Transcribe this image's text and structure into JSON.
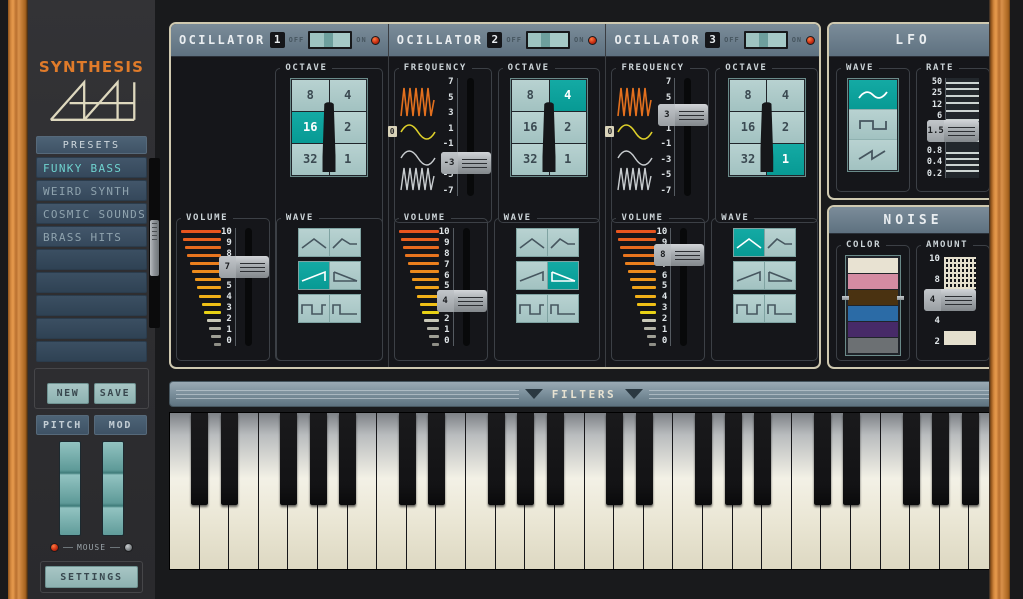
{
  "app": {
    "brand": "SYNTHESIS",
    "logo_icon": "sawtooth-logo"
  },
  "sidebar": {
    "presets_header": "PRESETS",
    "presets": [
      {
        "label": "FUNKY BASS",
        "selected": true
      },
      {
        "label": "WEIRD SYNTH",
        "selected": false
      },
      {
        "label": "COSMIC SOUNDS",
        "selected": false
      },
      {
        "label": "BRASS HITS",
        "selected": false
      },
      {
        "label": "",
        "selected": false
      },
      {
        "label": "",
        "selected": false
      },
      {
        "label": "",
        "selected": false
      },
      {
        "label": "",
        "selected": false
      },
      {
        "label": "",
        "selected": false
      }
    ],
    "new_label": "NEW",
    "save_label": "SAVE",
    "pitch_label": "PITCH",
    "mod_label": "MOD",
    "mouse_label": "MOUSE",
    "settings_label": "SETTINGS"
  },
  "oscillators": [
    {
      "title": "OCILLATOR",
      "number": "1",
      "off_label": "OFF",
      "on_label": "ON",
      "power": "mid",
      "has_frequency": false,
      "octave": {
        "label": "OCTAVE",
        "cells": [
          "8",
          "4",
          "16",
          "2",
          "32",
          "1"
        ],
        "selected": "16"
      },
      "volume": {
        "label": "VOLUME",
        "scale": [
          "10",
          "9",
          "8",
          "7",
          "6",
          "5",
          "4",
          "3",
          "2",
          "1",
          "0"
        ],
        "value": "7"
      },
      "wave": {
        "label": "WAVE",
        "icons": [
          "triangle",
          "ramp-step",
          "ramp-up",
          "ramp-down",
          "square",
          "pulse"
        ],
        "selected_index": 2
      }
    },
    {
      "title": "OCILLATOR",
      "number": "2",
      "off_label": "OFF",
      "on_label": "ON",
      "power": "mid",
      "has_frequency": true,
      "frequency": {
        "label": "FREQUENCY",
        "scale": [
          "7",
          "5",
          "3",
          "1",
          "-1",
          "-3",
          "-5",
          "-7"
        ],
        "zero_marker": "0",
        "value": "-3"
      },
      "octave": {
        "label": "OCTAVE",
        "cells": [
          "8",
          "4",
          "16",
          "2",
          "32",
          "1"
        ],
        "selected": "4"
      },
      "volume": {
        "label": "VOLUME",
        "scale": [
          "10",
          "9",
          "8",
          "7",
          "6",
          "5",
          "4",
          "3",
          "2",
          "1",
          "0"
        ],
        "value": "4"
      },
      "wave": {
        "label": "WAVE",
        "icons": [
          "triangle",
          "ramp-step",
          "ramp-up",
          "ramp-down",
          "square",
          "pulse"
        ],
        "selected_index": 3
      }
    },
    {
      "title": "OCILLATOR",
      "number": "3",
      "off_label": "OFF",
      "on_label": "ON",
      "power": "mid",
      "has_frequency": true,
      "frequency": {
        "label": "FREQUENCY",
        "scale": [
          "7",
          "5",
          "3",
          "1",
          "-1",
          "-3",
          "-5",
          "-7"
        ],
        "zero_marker": "0",
        "value": "3"
      },
      "octave": {
        "label": "OCTAVE",
        "cells": [
          "8",
          "4",
          "16",
          "2",
          "32",
          "1"
        ],
        "selected": "1"
      },
      "volume": {
        "label": "VOLUME",
        "scale": [
          "10",
          "9",
          "8",
          "7",
          "6",
          "5",
          "4",
          "3",
          "2",
          "1",
          "0"
        ],
        "value": "8"
      },
      "wave": {
        "label": "WAVE",
        "icons": [
          "triangle",
          "ramp-step",
          "ramp-up",
          "ramp-down",
          "square",
          "pulse"
        ],
        "selected_index": 0
      }
    }
  ],
  "lfo": {
    "title": "LFO",
    "wave": {
      "label": "WAVE",
      "icons": [
        "sine",
        "square",
        "sawtooth"
      ],
      "selected_index": 0
    },
    "rate": {
      "label": "RATE",
      "scale": [
        "50",
        "25",
        "12",
        "6",
        "3",
        "1.5",
        "0.8",
        "0.4",
        "0.2"
      ],
      "value": "1.5"
    }
  },
  "noise": {
    "title": "NOISE",
    "color": {
      "label": "COLOR",
      "swatches": [
        "#e8e2d2",
        "#d48ba2",
        "#4a3211",
        "#2b6ba6",
        "#472a68",
        "#6c7073"
      ],
      "names": [
        "white",
        "pink",
        "brown",
        "blue",
        "violet",
        "grey"
      ],
      "selected_index": 2
    },
    "amount": {
      "label": "AMOUNT",
      "scale": [
        "10",
        "8",
        "6",
        "4",
        "2"
      ],
      "value": "4"
    }
  },
  "filters": {
    "label": "FILTERS",
    "left_arrow": "triangle-down",
    "right_arrow": "triangle-down"
  },
  "keyboard": {
    "white_key_count": 28,
    "octaves": 4
  },
  "colors": {
    "accent_teal": "#0d9f99",
    "brand_orange": "#e07b2a",
    "panel_header": "#6b7e8c",
    "wood": "#d4893f"
  }
}
